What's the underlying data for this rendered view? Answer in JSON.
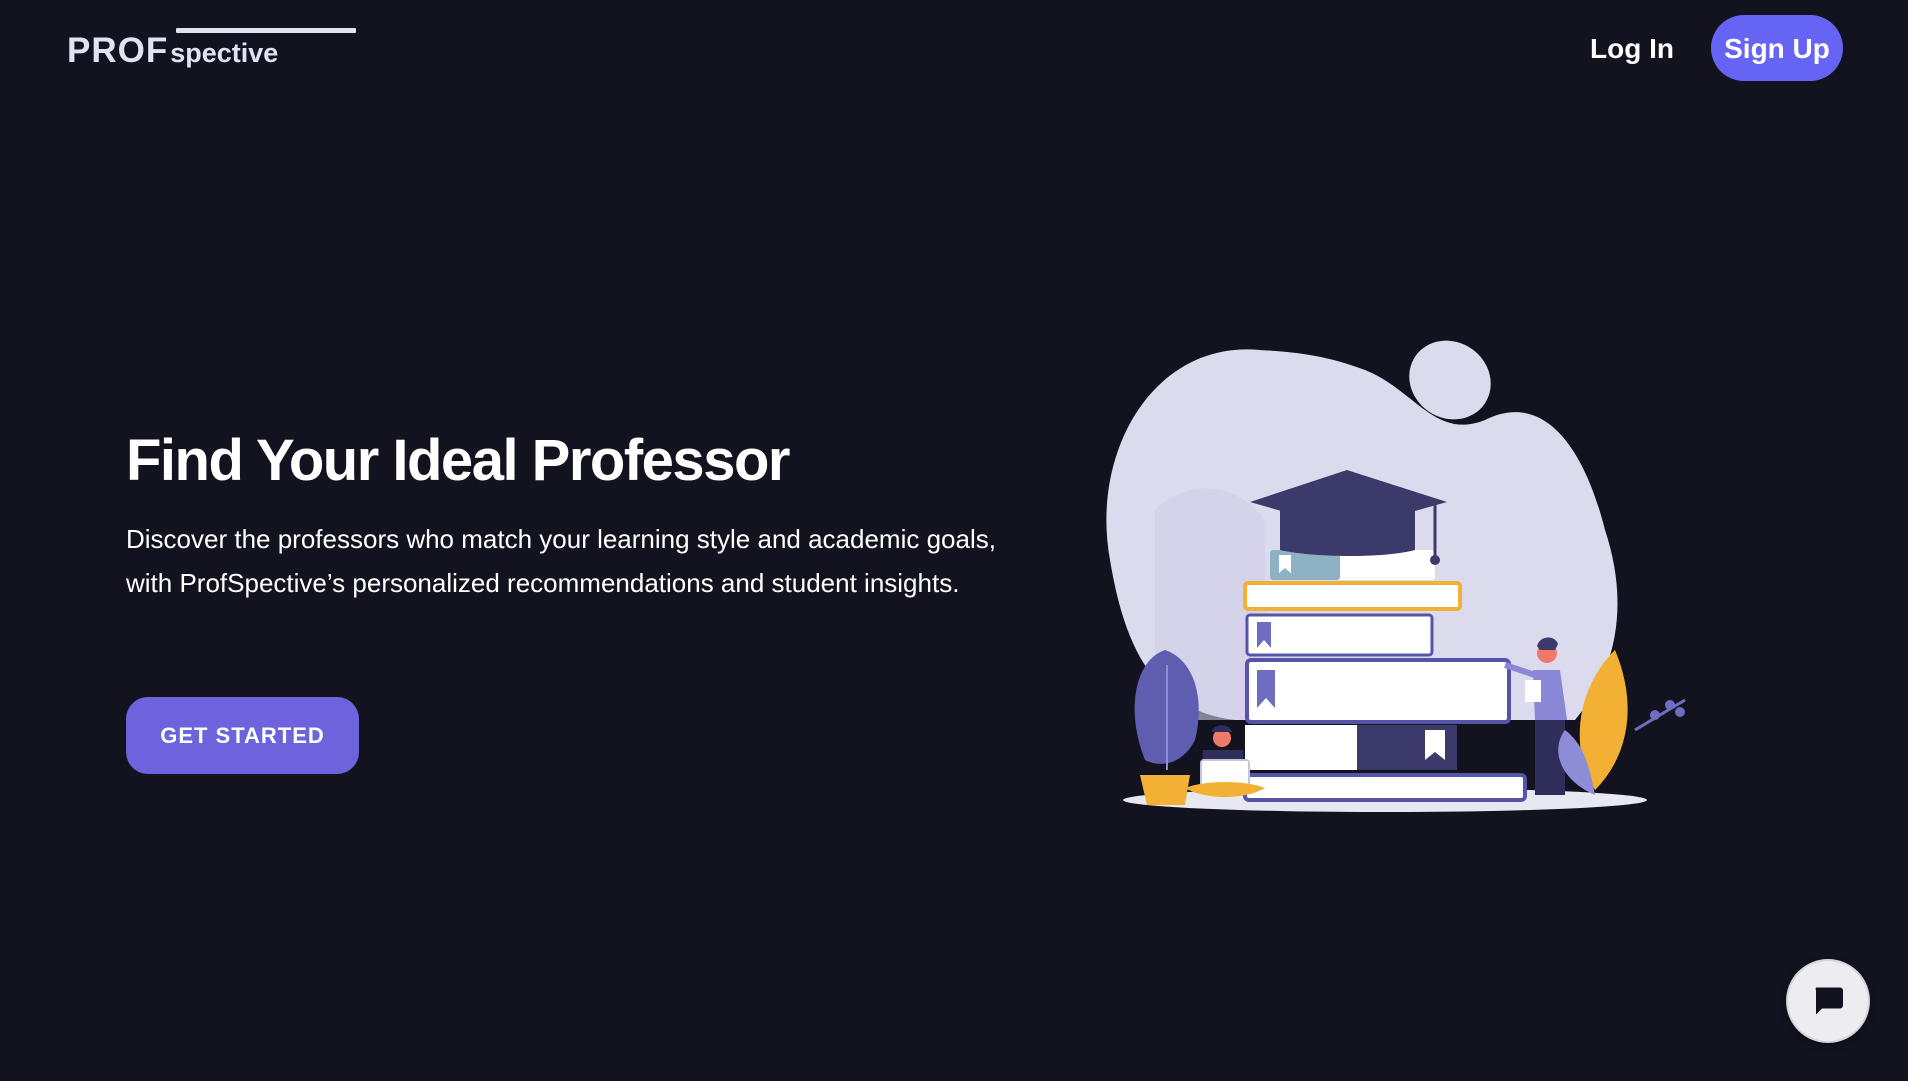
{
  "header": {
    "logo": {
      "prof": "PROF",
      "spective": "spective"
    },
    "nav": {
      "login_label": "Log In",
      "signup_label": "Sign Up"
    }
  },
  "hero": {
    "title": "Find Your Ideal Professor",
    "description": "Discover the professors who match your learning style and academic goals, with ProfSpective’s personalized recommendations and student insights.",
    "cta_label": "GET STARTED"
  },
  "illustration": {
    "icon": "graduation-books-illustration"
  },
  "chat": {
    "icon": "chat-bubble-icon"
  },
  "colors": {
    "background": "#13131f",
    "accent": "#6664f4",
    "cta": "#6c63dd",
    "logo": "#e3e2f5"
  }
}
